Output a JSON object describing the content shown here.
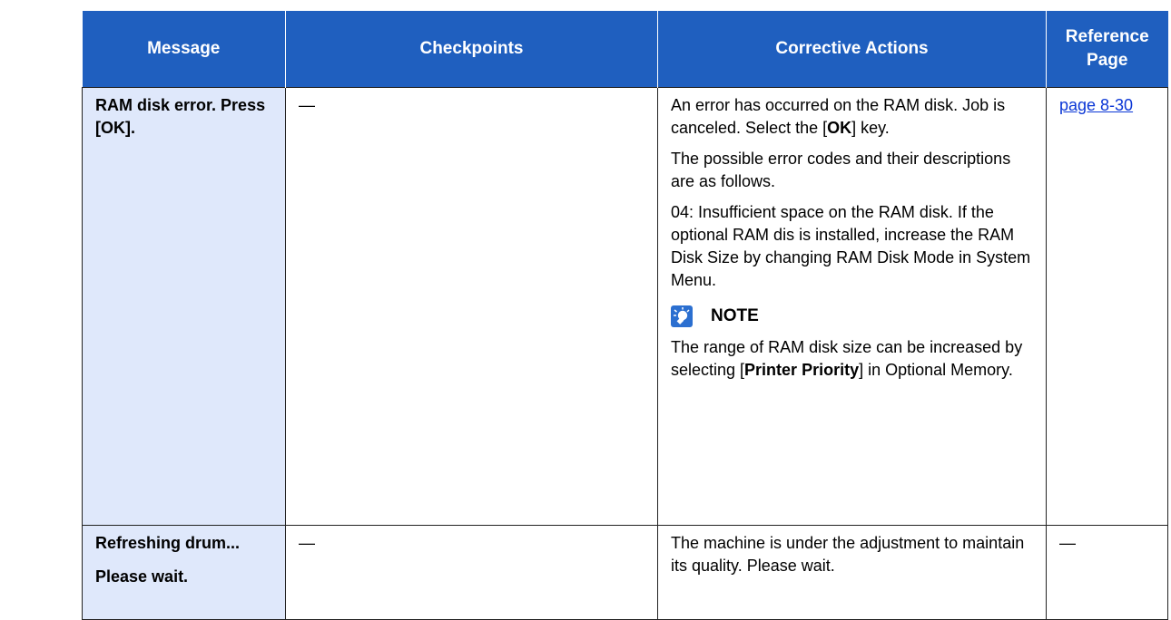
{
  "headers": [
    "Message",
    "Checkpoints",
    "Corrective Actions",
    "Reference\nPage"
  ],
  "header_lines": {
    "reference_1": "Reference",
    "reference_2": "Page"
  },
  "rows": [
    {
      "message": [
        "RAM disk error. Press [OK]."
      ],
      "checkpoints": "—",
      "actions": {
        "p1_a": "An error has occurred on the RAM disk. Job is canceled. Select the [",
        "p1_bold": "OK",
        "p1_b": "] key.",
        "p2": "The possible error codes and their descriptions are as follows.",
        "p3": "04: Insufficient space on the RAM disk. If the optional RAM dis is installed, increase the RAM Disk Size by changing RAM Disk Mode in System Menu.",
        "note_label": "NOTE",
        "note_a": "The range of RAM disk size can be increased by selecting [",
        "note_bold": "Printer Priority",
        "note_b": "] in Optional Memory."
      },
      "reference": "page 8-30"
    },
    {
      "message": [
        "Refreshing drum...",
        "Please wait."
      ],
      "checkpoints": "—",
      "actions": {
        "p1": "The machine is under the adjustment to maintain its quality. Please wait."
      },
      "reference": "—"
    }
  ],
  "colors": {
    "header_bg": "#1f5fbf",
    "message_bg": "#dfe8fb",
    "link": "#0a36d6"
  },
  "icons": {
    "note": "lightbulb-note-icon"
  }
}
